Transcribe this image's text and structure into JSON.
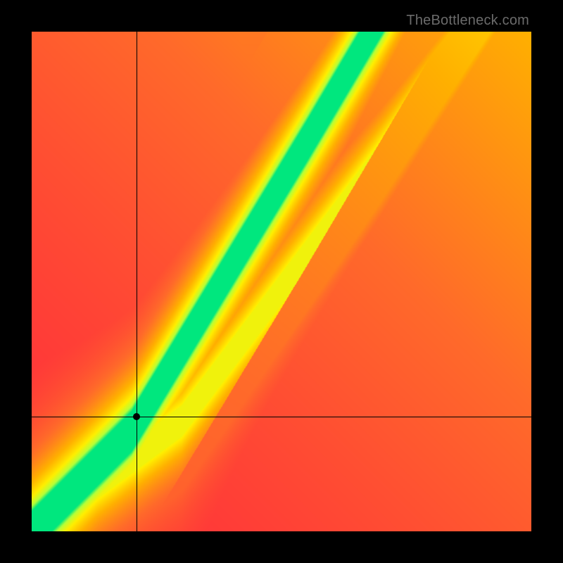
{
  "watermark": "TheBottleneck.com",
  "chart_data": {
    "type": "heatmap",
    "title": "",
    "xlabel": "",
    "ylabel": "",
    "xlim": [
      0,
      1
    ],
    "ylim": [
      0,
      1
    ],
    "grid": false,
    "legend": null,
    "crosshair": {
      "x": 0.21,
      "y": 0.23
    },
    "marker": {
      "x": 0.21,
      "y": 0.23
    },
    "optimal_ridge": {
      "description": "Green band center: required y (GPU score) for given x (CPU score). Piecewise-linear; slope ≈1 below knee, ≈1.65 above.",
      "points": [
        {
          "x": 0.0,
          "y": 0.0
        },
        {
          "x": 0.2,
          "y": 0.2
        },
        {
          "x": 0.55,
          "y": 0.78
        },
        {
          "x": 0.68,
          "y": 1.0
        }
      ],
      "band_half_width_y": 0.04
    },
    "secondary_ridge": {
      "description": "Faint yellow secondary band below the main green ridge.",
      "points": [
        {
          "x": 0.0,
          "y": 0.0
        },
        {
          "x": 0.3,
          "y": 0.22
        },
        {
          "x": 0.7,
          "y": 0.75
        },
        {
          "x": 0.88,
          "y": 1.0
        }
      ],
      "band_half_width_y": 0.03
    },
    "color_stops": {
      "description": "Value 0 = worst (red), 1 = best (green). Intermediate stops approximate the gradient.",
      "stops": [
        {
          "v": 0.0,
          "color": "#ff2f3b"
        },
        {
          "v": 0.3,
          "color": "#ff6a2a"
        },
        {
          "v": 0.55,
          "color": "#ffb000"
        },
        {
          "v": 0.75,
          "color": "#ffef00"
        },
        {
          "v": 0.9,
          "color": "#b4ff3a"
        },
        {
          "v": 1.0,
          "color": "#00e77e"
        }
      ]
    },
    "background_warmth": {
      "description": "Additive orange glow toward upper-right independent of ridge distance.",
      "corner": "top-right",
      "max_boost": 0.55
    }
  }
}
